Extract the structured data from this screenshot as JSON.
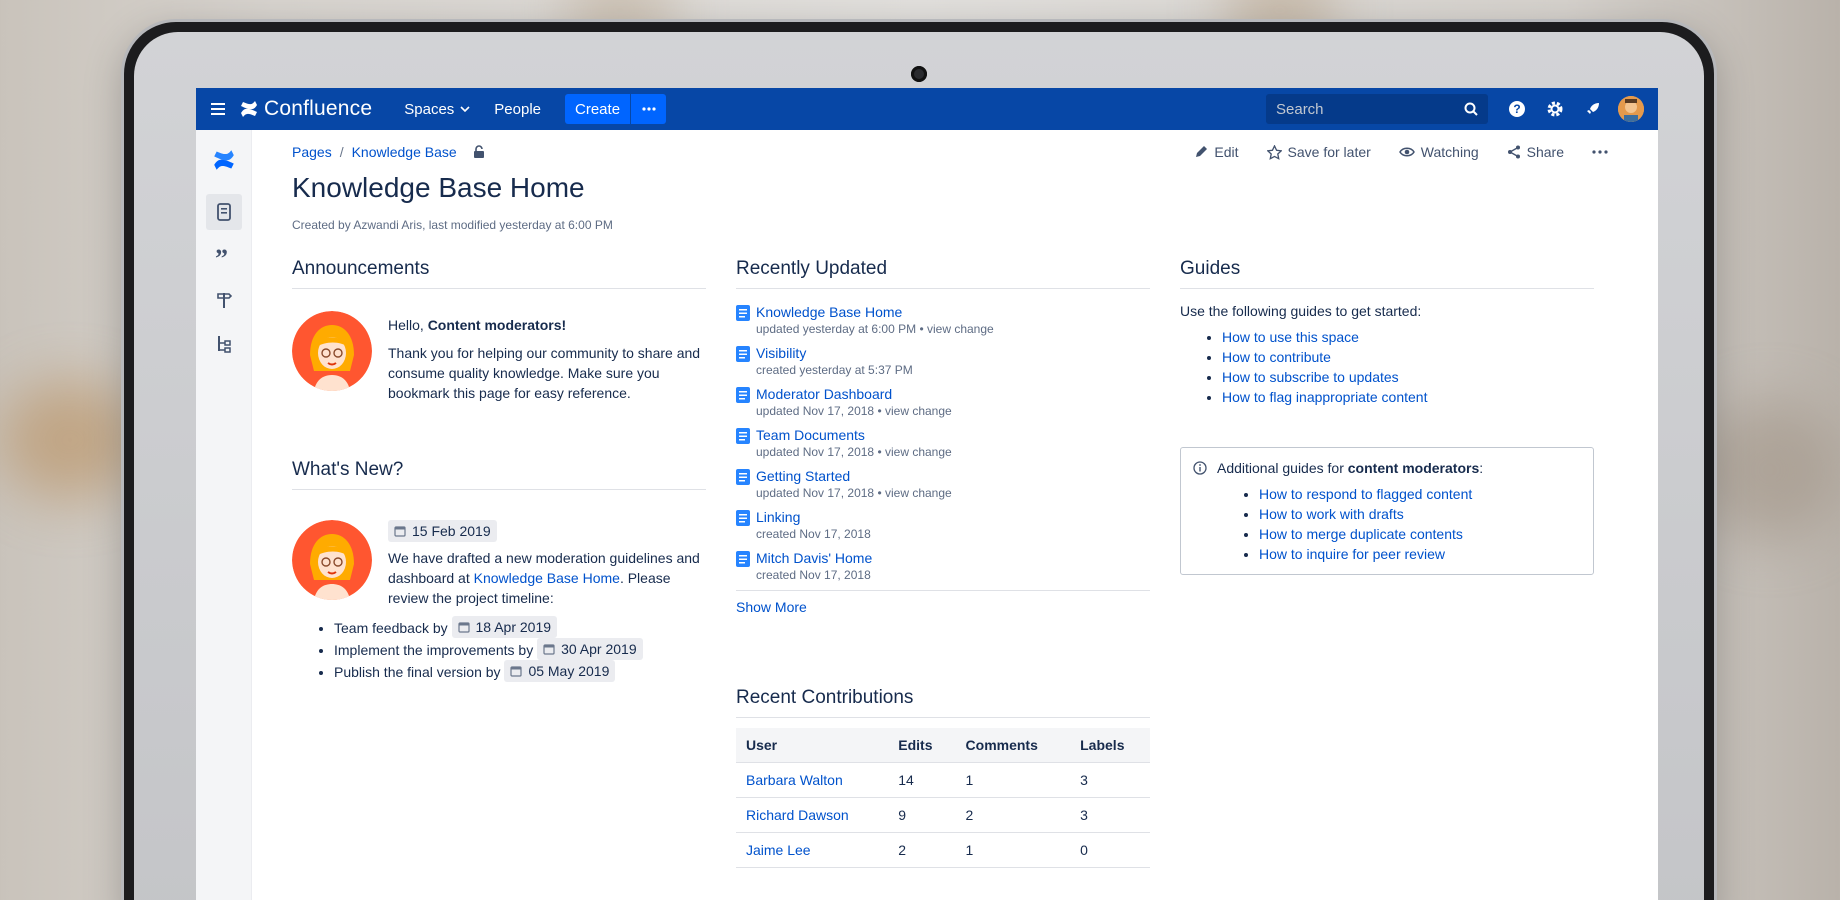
{
  "nav": {
    "brand": "Confluence",
    "spaces": "Spaces",
    "people": "People",
    "create": "Create",
    "search_placeholder": "Search"
  },
  "breadcrumb": {
    "root": "Pages",
    "current": "Knowledge Base"
  },
  "actions": {
    "edit": "Edit",
    "save": "Save for later",
    "watch": "Watching",
    "share": "Share"
  },
  "page": {
    "title": "Knowledge Base Home",
    "byline": "Created by Azwandi Aris, last modified yesterday at 6:00 PM"
  },
  "announcements": {
    "heading": "Announcements",
    "greeting_prefix": "Hello, ",
    "greeting_bold": "Content moderators!",
    "body": "Thank you for helping our community to share and consume quality knowledge. Make sure you bookmark this page for easy reference."
  },
  "whats_new": {
    "heading": "What's New?",
    "date": "15 Feb 2019",
    "text_prefix": "We have drafted a new moderation guidelines and dashboard at ",
    "link": "Knowledge Base Home",
    "text_suffix": ". Please review the project timeline:",
    "timeline": [
      {
        "label": "Team feedback by",
        "date": "18 Apr 2019"
      },
      {
        "label": "Implement the improvements by",
        "date": "30 Apr 2019"
      },
      {
        "label": "Publish the final version by",
        "date": "05 May 2019"
      }
    ]
  },
  "recently_updated": {
    "heading": "Recently Updated",
    "items": [
      {
        "title": "Knowledge Base Home",
        "meta": "updated yesterday at 6:00 PM",
        "change": "view change"
      },
      {
        "title": "Visibility",
        "meta": "created yesterday at 5:37 PM",
        "change": ""
      },
      {
        "title": "Moderator Dashboard",
        "meta": "updated Nov 17, 2018",
        "change": "view change"
      },
      {
        "title": "Team Documents",
        "meta": "updated Nov 17, 2018",
        "change": "view change"
      },
      {
        "title": "Getting Started",
        "meta": "updated Nov 17, 2018",
        "change": "view change"
      },
      {
        "title": "Linking",
        "meta": "created Nov 17, 2018",
        "change": ""
      },
      {
        "title": "Mitch Davis' Home",
        "meta": "created Nov 17, 2018",
        "change": ""
      }
    ],
    "show_more": "Show More"
  },
  "contributions": {
    "heading": "Recent Contributions",
    "columns": [
      "User",
      "Edits",
      "Comments",
      "Labels"
    ],
    "rows": [
      [
        "Barbara Walton",
        "14",
        "1",
        "3"
      ],
      [
        "Richard Dawson",
        "9",
        "2",
        "3"
      ],
      [
        "Jaime Lee",
        "2",
        "1",
        "0"
      ]
    ]
  },
  "guides": {
    "heading": "Guides",
    "intro": "Use the following guides to get started:",
    "links": [
      "How to use this space",
      "How to contribute",
      "How to subscribe to updates",
      "How to flag inappropriate content"
    ],
    "panel_prefix": "Additional guides for ",
    "panel_bold": "content moderators",
    "panel_suffix": ":",
    "panel_links": [
      "How to respond to flagged content",
      "How to work with drafts",
      "How to merge duplicate contents",
      "How to inquire for peer review"
    ]
  },
  "colors": {
    "nav": "#0747a6",
    "link": "#0052cc",
    "create": "#0065ff"
  }
}
